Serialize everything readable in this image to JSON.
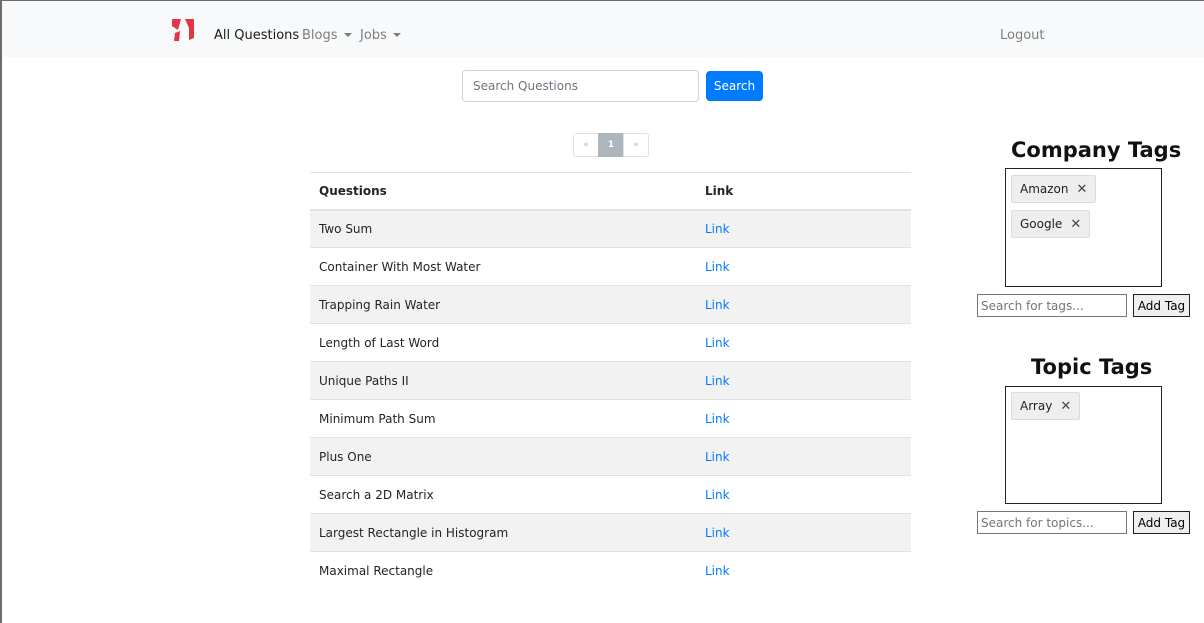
{
  "navbar": {
    "items": [
      {
        "label": "All Questions"
      },
      {
        "label": "Blogs"
      },
      {
        "label": "Jobs"
      }
    ],
    "logout_label": "Logout",
    "brand_color": "#e53545"
  },
  "search": {
    "placeholder": "Search Questions",
    "value": "",
    "button_label": "Search"
  },
  "pagination": {
    "prev": "«",
    "current": "1",
    "next": "»"
  },
  "table": {
    "headers": [
      "Questions",
      "Link"
    ],
    "rows": [
      {
        "question": "Two Sum",
        "link": "Link"
      },
      {
        "question": "Container With Most Water",
        "link": "Link"
      },
      {
        "question": "Trapping Rain Water",
        "link": "Link"
      },
      {
        "question": "Length of Last Word",
        "link": "Link"
      },
      {
        "question": "Unique Paths II",
        "link": "Link"
      },
      {
        "question": "Minimum Path Sum",
        "link": "Link"
      },
      {
        "question": "Plus One",
        "link": "Link"
      },
      {
        "question": "Search a 2D Matrix",
        "link": "Link"
      },
      {
        "question": "Largest Rectangle in Histogram",
        "link": "Link"
      },
      {
        "question": "Maximal Rectangle",
        "link": "Link"
      }
    ]
  },
  "company_tags": {
    "title": "Company Tags",
    "tags": [
      {
        "label": "Amazon",
        "remove": "✕"
      },
      {
        "label": "Google",
        "remove": "✕"
      }
    ],
    "input_placeholder": "Search for tags...",
    "button_label": "Add Tag"
  },
  "topic_tags": {
    "title": "Topic Tags",
    "tags": [
      {
        "label": "Array",
        "remove": "✕"
      }
    ],
    "input_placeholder": "Search for topics...",
    "button_label": "Add Tag"
  }
}
